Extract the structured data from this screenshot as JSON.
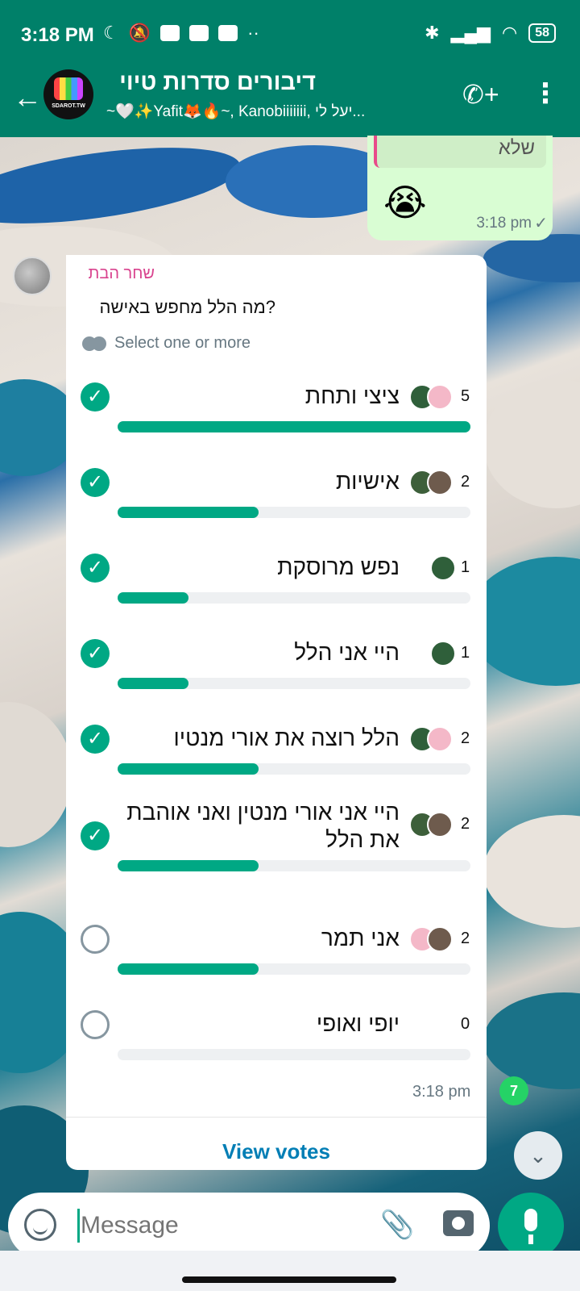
{
  "statusbar": {
    "time": "3:18 PM",
    "battery": "58"
  },
  "header": {
    "title": "דיבורים סדרות טיוי",
    "subtitle": "~🤍✨Yafit🦊🔥~, Kanobiiiiiii, יעל לי...",
    "avatar_text": "SDAROT.TW"
  },
  "outgoing": {
    "quote": "שלא",
    "emoji": "😭",
    "time": "3:18 pm",
    "tick": "✓"
  },
  "poll": {
    "sender": "שחר הבת",
    "question": "מה הלל מחפש באישה?",
    "hint": "Select one or more",
    "time": "3:18 pm",
    "view_votes": "View votes",
    "options": [
      {
        "label": "ציצי ותחת",
        "count": "5",
        "checked": true,
        "fraction": 1.0,
        "voters": [
          "#2f5f3a",
          "#f4b8c8"
        ]
      },
      {
        "label": "אישיות",
        "count": "2",
        "checked": true,
        "fraction": 0.4,
        "voters": [
          "#3d5f3a",
          "#6e5b4d"
        ]
      },
      {
        "label": "נפש מרוסקת",
        "count": "1",
        "checked": true,
        "fraction": 0.2,
        "voters": [
          "#2f5f3a"
        ]
      },
      {
        "label": "היי אני הלל",
        "count": "1",
        "checked": true,
        "fraction": 0.2,
        "voters": [
          "#2f5f3a"
        ]
      },
      {
        "label": "הלל רוצה את אורי מנטיו",
        "count": "2",
        "checked": true,
        "fraction": 0.4,
        "voters": [
          "#2f5f3a",
          "#f4b8c8"
        ]
      },
      {
        "label": "היי אני אורי מנטין ואני אוהבת את הלל",
        "count": "2",
        "checked": true,
        "fraction": 0.4,
        "voters": [
          "#3d5f3a",
          "#6e5b4d"
        ]
      },
      {
        "label": "אני תמר",
        "count": "2",
        "checked": false,
        "fraction": 0.4,
        "voters": [
          "#f4b8c8",
          "#6e5b4d"
        ]
      },
      {
        "label": "יופי ואופי",
        "count": "0",
        "checked": false,
        "fraction": 0.0,
        "voters": []
      }
    ]
  },
  "unread_count": "7",
  "input": {
    "placeholder": "Message"
  },
  "colors": {
    "accent": "#00a884",
    "header": "#008069",
    "bubble_out": "#d9fdd3",
    "sender_name": "#d9438e"
  }
}
